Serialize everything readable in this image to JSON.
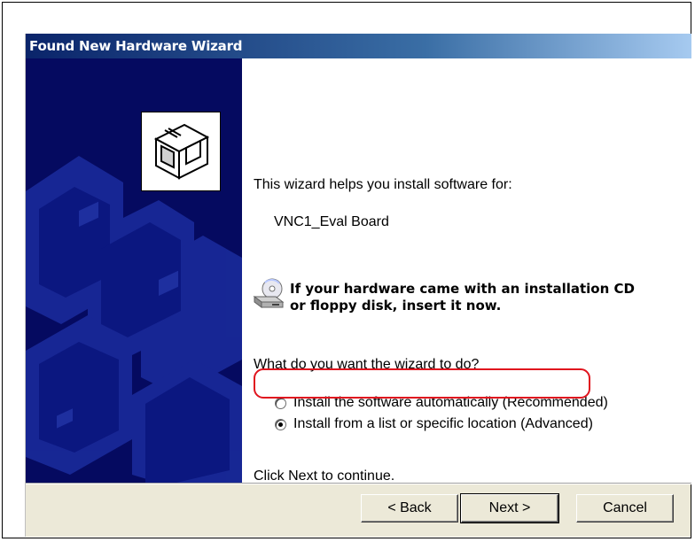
{
  "window": {
    "title": "Found New Hardware Wizard"
  },
  "intro": {
    "line": "This wizard helps you install software for:",
    "device_name": "VNC1_Eval Board"
  },
  "cd_notice": {
    "icon": "cd-drive-icon",
    "line1": "If your hardware came with an installation CD",
    "line2": "or floppy disk, insert it now."
  },
  "question": "What do you want the wizard to do?",
  "options": [
    {
      "label": "Install the software automatically (Recommended)",
      "selected": false
    },
    {
      "label": "Install from a list or specific location (Advanced)",
      "selected": true
    }
  ],
  "continue_hint": "Click Next to continue.",
  "buttons": {
    "back": "< Back",
    "next": "Next >",
    "cancel": "Cancel"
  },
  "colors": {
    "title_bar": "#0a246a",
    "banner": "#050a60",
    "highlight": "#e0141e"
  }
}
